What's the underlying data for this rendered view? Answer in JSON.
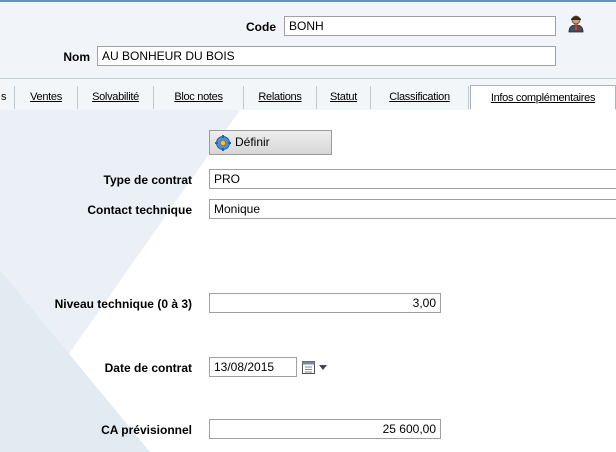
{
  "header": {
    "code_label": "Code",
    "code_value": "BONH",
    "nom_label": "Nom",
    "nom_value": "AU BONHEUR DU BOIS",
    "user_icon": "person-icon"
  },
  "tabs": [
    {
      "label": "s",
      "active": false
    },
    {
      "label": "Ventes",
      "active": false
    },
    {
      "label": "Solvabilité",
      "active": false
    },
    {
      "label": "Bloc notes",
      "active": false
    },
    {
      "label": "Relations",
      "active": false
    },
    {
      "label": "Statut",
      "active": false
    },
    {
      "label": "Classification",
      "active": false
    },
    {
      "label": "Infos complémentaires",
      "active": true
    }
  ],
  "form": {
    "definir_label": "Définir",
    "definir_icon": "gear-icon",
    "type_contrat_label": "Type de contrat",
    "type_contrat_value": "PRO",
    "contact_technique_label": "Contact technique",
    "contact_technique_value": "Monique",
    "niveau_label": "Niveau technique (0 à 3)",
    "niveau_value": "3,00",
    "date_label": "Date de contrat",
    "date_value": "13/08/2015",
    "ca_label": "CA prévisionnel",
    "ca_value": "25 600,00"
  },
  "colors": {
    "accent": "#6a8fb3",
    "panel_bg": "#f3f6f9"
  }
}
